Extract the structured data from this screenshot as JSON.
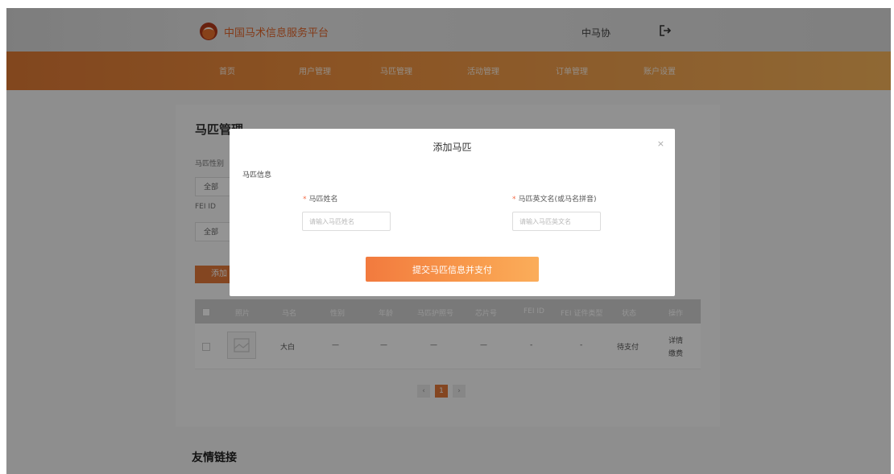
{
  "header": {
    "site_title": "中国马术信息服务平台",
    "org_name": "中马协",
    "logo_icon": "horse-logo-icon",
    "logout_icon": "logout-icon"
  },
  "nav": {
    "items": [
      "首页",
      "用户管理",
      "马匹管理",
      "活动管理",
      "订单管理",
      "账户设置"
    ]
  },
  "page": {
    "title": "马匹管理",
    "filters": [
      {
        "label": "马匹性别",
        "value": "全部"
      },
      {
        "label": "FEI ID",
        "value": "全部"
      }
    ],
    "add_button": "添加",
    "table": {
      "headers": [
        "照片",
        "马名",
        "性别",
        "年龄",
        "马匹护照号",
        "芯片号",
        "FEI ID",
        "FEI 证件类型",
        "状态",
        "操作"
      ],
      "rows": [
        {
          "name": "大白",
          "gender": "—",
          "age": "—",
          "passport": "—",
          "chip": "—",
          "fei_id": "-",
          "fei_type": "-",
          "status": "待支付",
          "action1": "详情",
          "action2": "缴费"
        }
      ]
    },
    "pagination": {
      "prev": "‹",
      "current": "1",
      "next": "›"
    },
    "friend_links": "友情链接"
  },
  "modal": {
    "title": "添加马匹",
    "close": "×",
    "section": "马匹信息",
    "required_mark": "*",
    "fields": [
      {
        "label": "马匹姓名",
        "placeholder": "请输入马匹姓名"
      },
      {
        "label": "马匹英文名(或马名拼音)",
        "placeholder": "请输入马匹英文名"
      }
    ],
    "submit": "提交马匹信息并支付"
  },
  "colors": {
    "accent": "#f27a3e",
    "nav_gradient_start": "#e07a35",
    "nav_gradient_end": "#f7b45a",
    "required": "#f46b45"
  }
}
